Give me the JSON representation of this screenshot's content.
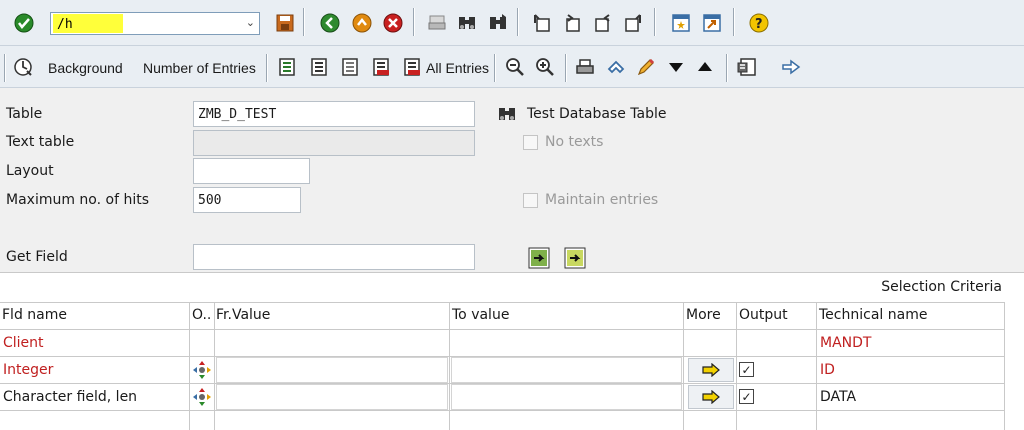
{
  "toolbar": {
    "command_value": "/h",
    "background_label": "Background",
    "number_of_entries_label": "Number of Entries",
    "all_entries_label": "All Entries"
  },
  "form": {
    "table_label": "Table",
    "table_value": "ZMB_D_TEST",
    "table_description": "Test Database Table",
    "text_table_label": "Text table",
    "text_table_value": "",
    "no_texts_label": "No texts",
    "layout_label": "Layout",
    "layout_value": "",
    "max_hits_label": "Maximum no. of hits",
    "max_hits_value": "500",
    "maintain_entries_label": "Maintain entries",
    "get_field_label": "Get Field",
    "get_field_value": ""
  },
  "grid": {
    "title": "Selection Criteria",
    "headers": {
      "fld_name": "Fld name",
      "option": "O..",
      "fr_value": "Fr.Value",
      "to_value": "To value",
      "more": "More",
      "output": "Output",
      "technical_name": "Technical name"
    },
    "rows": [
      {
        "fld_name": "Client",
        "technical_name": "MANDT"
      },
      {
        "fld_name": "Integer",
        "technical_name": "ID"
      },
      {
        "fld_name": "Character field, len",
        "technical_name": "DATA"
      }
    ]
  },
  "colors": {
    "accent_highlight": "#ffff3a",
    "key_field_red": "#c02020"
  },
  "icons": [
    "enter-icon",
    "save-icon",
    "back-icon",
    "exit-icon",
    "cancel-icon",
    "print-icon",
    "find-icon",
    "find-next-icon",
    "first-page-icon",
    "prev-page-icon",
    "next-page-icon",
    "last-page-icon",
    "new-session-icon",
    "shortcut-icon",
    "help-icon",
    "execute-icon",
    "select-options-icon",
    "more-arrow-icon"
  ]
}
